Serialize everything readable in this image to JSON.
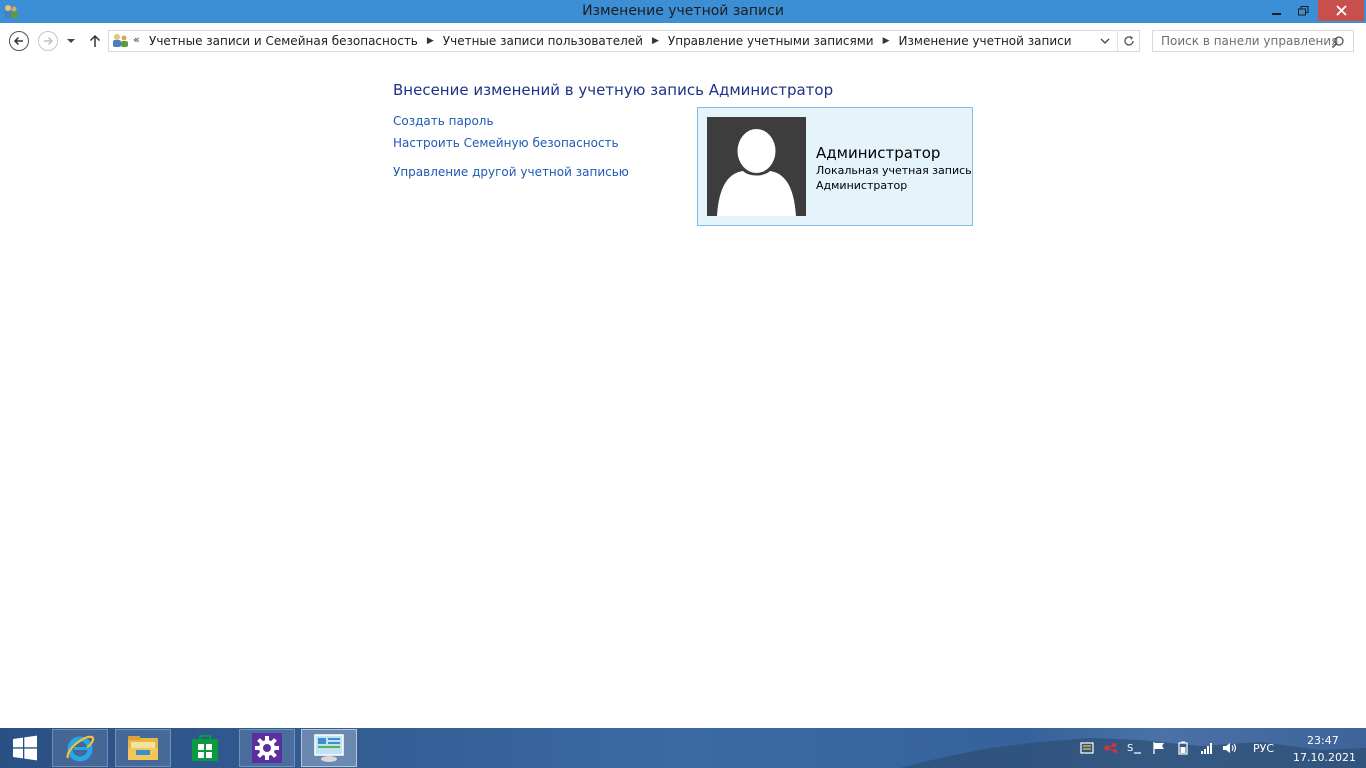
{
  "window": {
    "title": "Изменение учетной записи"
  },
  "nav": {
    "breadcrumb_prefix": "«",
    "crumbs": [
      "Учетные записи и Семейная безопасность",
      "Учетные записи пользователей",
      "Управление учетными записями",
      "Изменение учетной записи"
    ],
    "search_placeholder": "Поиск в панели управления"
  },
  "main": {
    "heading": "Внесение изменений в учетную запись Администратор",
    "links": {
      "create_password": "Создать пароль",
      "family_safety": "Настроить Семейную безопасность",
      "manage_other": "Управление другой учетной записью"
    }
  },
  "account": {
    "name": "Администратор",
    "type": "Локальная учетная запись",
    "group": "Администратор"
  },
  "taskbar": {
    "apps": [
      "start-icon",
      "internet-explorer-icon",
      "file-explorer-icon",
      "store-icon",
      "settings-icon",
      "control-panel-icon"
    ],
    "language": "РУС",
    "time": "23:47",
    "date": "17.10.2021"
  },
  "colors": {
    "titlebar": "#3c8fd4",
    "close_button": "#c7504c",
    "link": "#1e5ab4",
    "heading": "#1e3287",
    "card_bg": "#e5f3fb",
    "card_border": "#7dbfe6"
  }
}
